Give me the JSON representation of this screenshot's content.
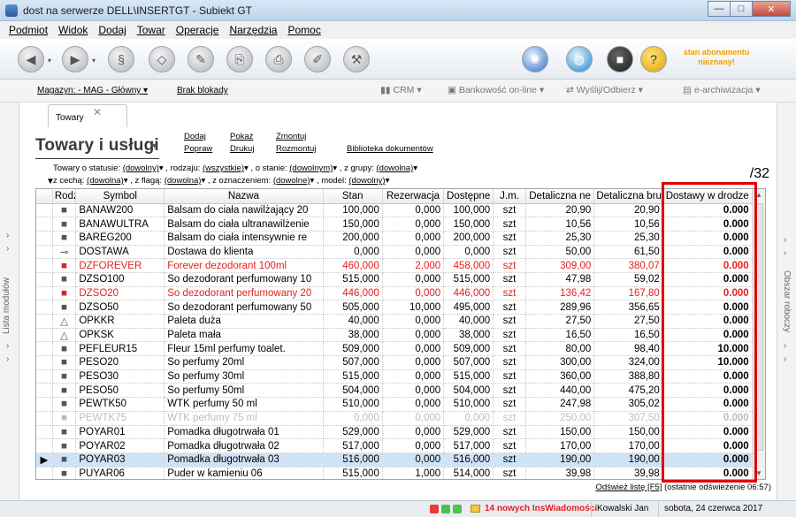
{
  "window": {
    "title": "dost na serwerze DELL\\INSERTGT - Subiekt GT",
    "buttons": {
      "minimize": "—",
      "maximize": "□",
      "close": "✕"
    }
  },
  "menu": [
    "Podmiot",
    "Widok",
    "Dodaj",
    "Towar",
    "Operacje",
    "Narzędzia",
    "Pomoc"
  ],
  "toolbar": {
    "subscription_notice_line1": "stan abonamentu",
    "subscription_notice_line2": "nieznany!"
  },
  "toprow": {
    "warehouse": "Magazyn: - MAG - Główny",
    "lock": "Brak blokady",
    "crm": "CRM",
    "banking": "Bankowość on-line",
    "send": "Wyślij/Odbierz",
    "archive": "e-archiwizacja"
  },
  "side": {
    "left": "Lista modułów",
    "right": "Obszar roboczy"
  },
  "tab": {
    "label": "Towary",
    "close": "✕"
  },
  "page": {
    "title": "Towary i usługi",
    "actions": {
      "add": "Dodaj",
      "fix": "Popraw",
      "show": "Pokaż",
      "print": "Drukuj",
      "assemble": "Zmontuj",
      "disassemble": "Rozmontuj",
      "docs": "Biblioteka dokumentów"
    },
    "filters": {
      "status_label": "Towary o statusie:",
      "status_value": "(dowolny)",
      "type_label": ", rodzaju:",
      "type_value": "(wszystkie)",
      "state_label": ", o stanie:",
      "state_value": "(dowolnym)",
      "group_label": ", z grupy:",
      "group_value": "(dowolna)",
      "feature_label": "z cechą:",
      "feature_value": "(dowolna)",
      "flag_label": ", z flagą:",
      "flag_value": "(dowolna)",
      "mark_label": ", z oznaczeniem:",
      "mark_value": "(dowolne)",
      "model_label": ", model:",
      "model_value": "(dowolny)"
    },
    "count": "/32"
  },
  "grid": {
    "columns": [
      "Rodz",
      "Symbol",
      "Nazwa",
      "Stan",
      "Rezerwacja",
      "Dostępne",
      "J.m.",
      "Detaliczna ne",
      "Detaliczna brut",
      "Dostawy w drodze"
    ],
    "rows": [
      {
        "rodz": "■",
        "symbol": "BANAW200",
        "nazwa": "Balsam do ciała nawilżający 20",
        "stan": "100,000",
        "rez": "0,000",
        "dost": "100,000",
        "jm": "szt",
        "netto": "20,90",
        "brutto": "20,90",
        "droga": "0.000",
        "style": ""
      },
      {
        "rodz": "■",
        "symbol": "BANAWULTRA",
        "nazwa": "Balsam do ciała ultranawilżenie",
        "stan": "150,000",
        "rez": "0,000",
        "dost": "150,000",
        "jm": "szt",
        "netto": "10,56",
        "brutto": "10,56",
        "droga": "0.000",
        "style": ""
      },
      {
        "rodz": "■",
        "symbol": "BAREG200",
        "nazwa": "Balsam do ciała intensywnie re",
        "stan": "200,000",
        "rez": "0,000",
        "dost": "200,000",
        "jm": "szt",
        "netto": "25,30",
        "brutto": "25,30",
        "droga": "0.000",
        "style": ""
      },
      {
        "rodz": "⊸",
        "symbol": "DOSTAWA",
        "nazwa": "Dostawa do klienta",
        "stan": "0,000",
        "rez": "0,000",
        "dost": "0,000",
        "jm": "szt",
        "netto": "50,00",
        "brutto": "61,50",
        "droga": "0.000",
        "style": ""
      },
      {
        "rodz": "■",
        "symbol": "DZFOREVER",
        "nazwa": "Forever dezodorant 100ml",
        "stan": "460,000",
        "rez": "2,000",
        "dost": "458,000",
        "jm": "szt",
        "netto": "309,00",
        "brutto": "380,07",
        "droga": "0.000",
        "style": "red"
      },
      {
        "rodz": "■",
        "symbol": "DZSO100",
        "nazwa": "So dezodorant perfumowany 10",
        "stan": "515,000",
        "rez": "0,000",
        "dost": "515,000",
        "jm": "szt",
        "netto": "47,98",
        "brutto": "59,02",
        "droga": "0.000",
        "style": ""
      },
      {
        "rodz": "■",
        "symbol": "DZSO20",
        "nazwa": "So dezodorant perfumowany 20",
        "stan": "446,000",
        "rez": "0,000",
        "dost": "446,000",
        "jm": "szt",
        "netto": "136,42",
        "brutto": "167,80",
        "droga": "0.000",
        "style": "red"
      },
      {
        "rodz": "■",
        "symbol": "DZSO50",
        "nazwa": "So dezodorant perfumowany 50",
        "stan": "505,000",
        "rez": "10,000",
        "dost": "495,000",
        "jm": "szt",
        "netto": "289,96",
        "brutto": "356,65",
        "droga": "0.000",
        "style": ""
      },
      {
        "rodz": "△",
        "symbol": "OPKKR",
        "nazwa": "Paleta duża",
        "stan": "40,000",
        "rez": "0,000",
        "dost": "40,000",
        "jm": "szt",
        "netto": "27,50",
        "brutto": "27,50",
        "droga": "0.000",
        "style": ""
      },
      {
        "rodz": "△",
        "symbol": "OPKSK",
        "nazwa": "Paleta mała",
        "stan": "38,000",
        "rez": "0,000",
        "dost": "38,000",
        "jm": "szt",
        "netto": "16,50",
        "brutto": "16,50",
        "droga": "0.000",
        "style": ""
      },
      {
        "rodz": "■",
        "symbol": "PEFLEUR15",
        "nazwa": "Fleur 15ml perfumy toalet.",
        "stan": "509,000",
        "rez": "0,000",
        "dost": "509,000",
        "jm": "szt",
        "netto": "80,00",
        "brutto": "98,40",
        "droga": "10.000",
        "style": ""
      },
      {
        "rodz": "■",
        "symbol": "PESO20",
        "nazwa": "So perfumy 20ml",
        "stan": "507,000",
        "rez": "0,000",
        "dost": "507,000",
        "jm": "szt",
        "netto": "300,00",
        "brutto": "324,00",
        "droga": "10.000",
        "style": ""
      },
      {
        "rodz": "■",
        "symbol": "PESO30",
        "nazwa": "So perfumy 30ml",
        "stan": "515,000",
        "rez": "0,000",
        "dost": "515,000",
        "jm": "szt",
        "netto": "360,00",
        "brutto": "388,80",
        "droga": "0.000",
        "style": ""
      },
      {
        "rodz": "■",
        "symbol": "PESO50",
        "nazwa": "So perfumy 50ml",
        "stan": "504,000",
        "rez": "0,000",
        "dost": "504,000",
        "jm": "szt",
        "netto": "440,00",
        "brutto": "475,20",
        "droga": "0.000",
        "style": ""
      },
      {
        "rodz": "■",
        "symbol": "PEWTK50",
        "nazwa": "WTK perfumy 50 ml",
        "stan": "510,000",
        "rez": "0,000",
        "dost": "510,000",
        "jm": "szt",
        "netto": "247,98",
        "brutto": "305,02",
        "droga": "0.000",
        "style": ""
      },
      {
        "rodz": "■",
        "symbol": "PEWTK75",
        "nazwa": "WTK perfumy 75 ml",
        "stan": "0,000",
        "rez": "0,000",
        "dost": "0,000",
        "jm": "szt",
        "netto": "250,00",
        "brutto": "307,50",
        "droga": "0.000",
        "style": "grey"
      },
      {
        "rodz": "■",
        "symbol": "POYAR01",
        "nazwa": "Pomadka długotrwała 01",
        "stan": "529,000",
        "rez": "0,000",
        "dost": "529,000",
        "jm": "szt",
        "netto": "150,00",
        "brutto": "150,00",
        "droga": "0.000",
        "style": ""
      },
      {
        "rodz": "■",
        "symbol": "POYAR02",
        "nazwa": "Pomadka długotrwała 02",
        "stan": "517,000",
        "rez": "0,000",
        "dost": "517,000",
        "jm": "szt",
        "netto": "170,00",
        "brutto": "170,00",
        "droga": "0.000",
        "style": ""
      },
      {
        "rodz": "■",
        "symbol": "POYAR03",
        "nazwa": "Pomadka długotrwała 03",
        "stan": "516,000",
        "rez": "0,000",
        "dost": "516,000",
        "jm": "szt",
        "netto": "190,00",
        "brutto": "190,00",
        "droga": "0.000",
        "style": "active"
      },
      {
        "rodz": "■",
        "symbol": "PUYAR06",
        "nazwa": "Puder w kamieniu 06",
        "stan": "515,000",
        "rez": "1,000",
        "dost": "514,000",
        "jm": "szt",
        "netto": "39,98",
        "brutto": "39,98",
        "droga": "0.000",
        "style": ""
      }
    ]
  },
  "refresh": {
    "link": "Odśwież listę [F5]",
    "info": "(ostatnie odświeżenie 06:57)"
  },
  "status": {
    "news": "14 nowych InsWiadomości",
    "user": "Kowalski Jan",
    "date": "sobota, 24 czerwca 2017"
  },
  "colors": {
    "accent_red": "#e00000",
    "row_red": "#e52020",
    "selected_row": "#cfe3f6"
  }
}
